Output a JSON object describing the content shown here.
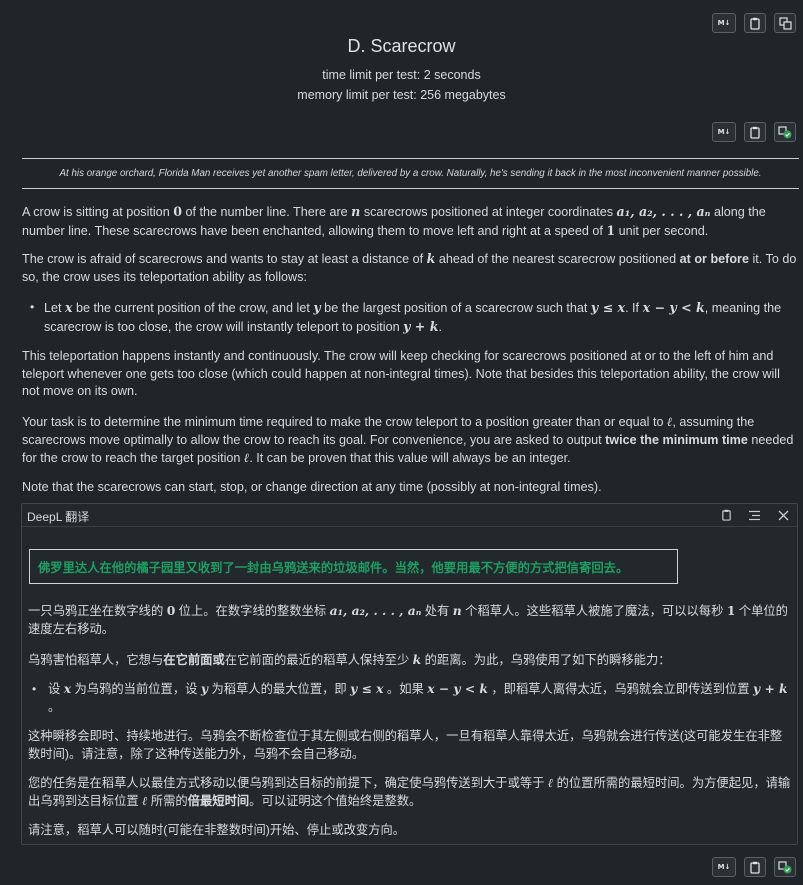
{
  "toolbar_top": {
    "md_label": "M↓"
  },
  "problem": {
    "title": "D. Scarecrow",
    "time_limit": "time limit per test: 2 seconds",
    "memory_limit": "memory limit per test: 256 megabytes",
    "epigraph": "At his orange orchard, Florida Man receives yet another spam letter, delivered by a crow. Naturally, he's sending it back in the most inconvenient manner possible."
  },
  "statement": {
    "p1": {
      "t1": "A crow is sitting at position ",
      "m1": "0",
      "t2": " of the number line. There are ",
      "m2": "n",
      "t3": " scarecrows positioned at integer coordinates ",
      "m3": "a₁, a₂, . . . , aₙ",
      "t4": " along the number line. These scarecrows have been enchanted, allowing them to move left and right at a speed of ",
      "m4": "1",
      "t5": " unit per second."
    },
    "p2": {
      "t1": "The crow is afraid of scarecrows and wants to stay at least a distance of ",
      "m1": "k",
      "t2": " ahead of the nearest scarecrow positioned ",
      "b1": "at or before",
      "t3": " it. To do so, the crow uses its teleportation ability as follows:"
    },
    "bullet": {
      "t1": "Let ",
      "m1": "x",
      "t2": " be the current position of the crow, and let ",
      "m2": "y",
      "t3": " be the largest position of a scarecrow such that ",
      "m3": "y ≤ x",
      "t4": ". If ",
      "m4": "x − y < k",
      "t5": ", meaning the scarecrow is too close, the crow will instantly teleport to position ",
      "m5": "y + k",
      "t6": "."
    },
    "p3": "This teleportation happens instantly and continuously. The crow will keep checking for scarecrows positioned at or to the left of him and teleport whenever one gets too close (which could happen at non-integral times). Note that besides this teleportation ability, the crow will not move on its own.",
    "p4": {
      "t1": "Your task is to determine the minimum time required to make the crow teleport to a position greater than or equal to ",
      "m1": "ℓ",
      "t2": ", assuming the scarecrows move optimally to allow the crow to reach its goal. For convenience, you are asked to output ",
      "b1": "twice the minimum time",
      "t3": " needed for the crow to reach the target position ",
      "m2": "ℓ",
      "t4": ". It can be proven that this value will always be an integer."
    },
    "p5": "Note that the scarecrows can start, stop, or change direction at any time (possibly at non-integral times)."
  },
  "translator": {
    "title": "DeepL 翻译",
    "highlight": "佛罗里达人在他的橘子园里又收到了一封由乌鸦送来的垃圾邮件。当然，他要用最不方便的方式把信寄回去。",
    "c1": {
      "t1": "一只乌鸦正坐在数字线的 ",
      "m1": "0",
      "t2": " 位上。在数字线的整数坐标 ",
      "m2": "a₁, a₂, . . . , aₙ",
      "t3": " 处有 ",
      "m3": "n",
      "t4": " 个稻草人。这些稻草人被施了魔法，可以以每秒 ",
      "m4": "1",
      "t5": " 个单位的速度左右移动。"
    },
    "c2": {
      "t1": "乌鸦害怕稻草人，它想与",
      "b1": "在它前面或",
      "t2": "在它前面的最近的稻草人保持至少 ",
      "m1": "k",
      "t3": " 的距离。为此，乌鸦使用了如下的瞬移能力："
    },
    "c3": {
      "t1": "设 ",
      "m1": "x",
      "t2": " 为乌鸦的当前位置，设 ",
      "m2": "y",
      "t3": " 为稻草人的最大位置，即 ",
      "m3": "y ≤ x",
      "t4": " 。如果 ",
      "m4": "x − y < k",
      "t5": " ，即稻草人离得太近，乌鸦就会立即传送到位置 ",
      "m5": "y + k",
      "t6": " 。"
    },
    "c4": "这种瞬移会即时、持续地进行。乌鸦会不断检查位于其左侧或右侧的稻草人，一旦有稻草人靠得太近，乌鸦就会进行传送(这可能发生在非整数时间)。请注意，除了这种传送能力外，乌鸦不会自己移动。",
    "c5": {
      "t1": "您的任务是在稻草人以最佳方式移动以便乌鸦到达目标的前提下，确定使乌鸦传送到大于或等于 ",
      "m1": "ℓ",
      "t2": " 的位置所需的最短时间。为方便起见，请输出乌鸦到达目标位置 ",
      "m2": "ℓ",
      "t3": " 所需的",
      "b1": "倍最短时间",
      "t4": "。可以证明这个值始终是整数。"
    },
    "c6": "请注意，稻草人可以随时(可能在非整数时间)开始、停止或改变方向。"
  },
  "colors": {
    "background": "#202529",
    "accent_green": "#1e9e63"
  }
}
